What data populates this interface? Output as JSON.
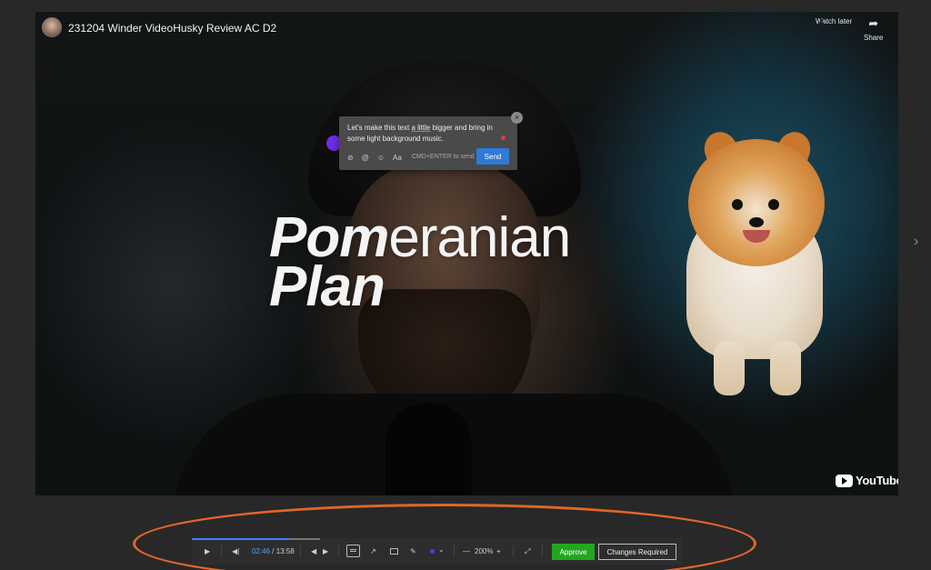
{
  "video": {
    "title": "231204 Winder VideoHusky Review AC D2",
    "headline_bold": "Pom",
    "headline_rest": "eranian",
    "headline_line2": "Plan",
    "watch_later": "Watch later",
    "share": "Share",
    "brand": "YouTube"
  },
  "comment": {
    "text_before": "Let's make this text ",
    "text_underlined": "a little",
    "text_after": " bigger and bring in some light background music.",
    "hint": "CMD+ENTER to send",
    "send_label": "Send",
    "tools": [
      "attachment-icon",
      "mention-icon",
      "emoji-icon",
      "text-format-icon"
    ],
    "tool_glyphs": [
      "⊘",
      "@",
      "☺",
      "Aa"
    ],
    "close_glyph": "×"
  },
  "controls": {
    "current_time": "02:46",
    "total_time": "13:58",
    "progress_percent": 19.8,
    "zoom": "200%",
    "approve_label": "Approve",
    "changes_label": "Changes Required",
    "glyphs": {
      "play": "▶",
      "frame_back": "◀|",
      "prev": "◀",
      "next": "▶",
      "arrow": "↗",
      "pen": "✎",
      "chevron": "⌄",
      "minus": "—",
      "plus": "+",
      "expand": "⤢",
      "next_page": "›",
      "share": "➦"
    }
  },
  "colors": {
    "accent_blue": "#3b82f6",
    "approve_green": "#22a71f",
    "annotation_orange": "#e0672a",
    "marker_purple": "#6b2ee6"
  }
}
